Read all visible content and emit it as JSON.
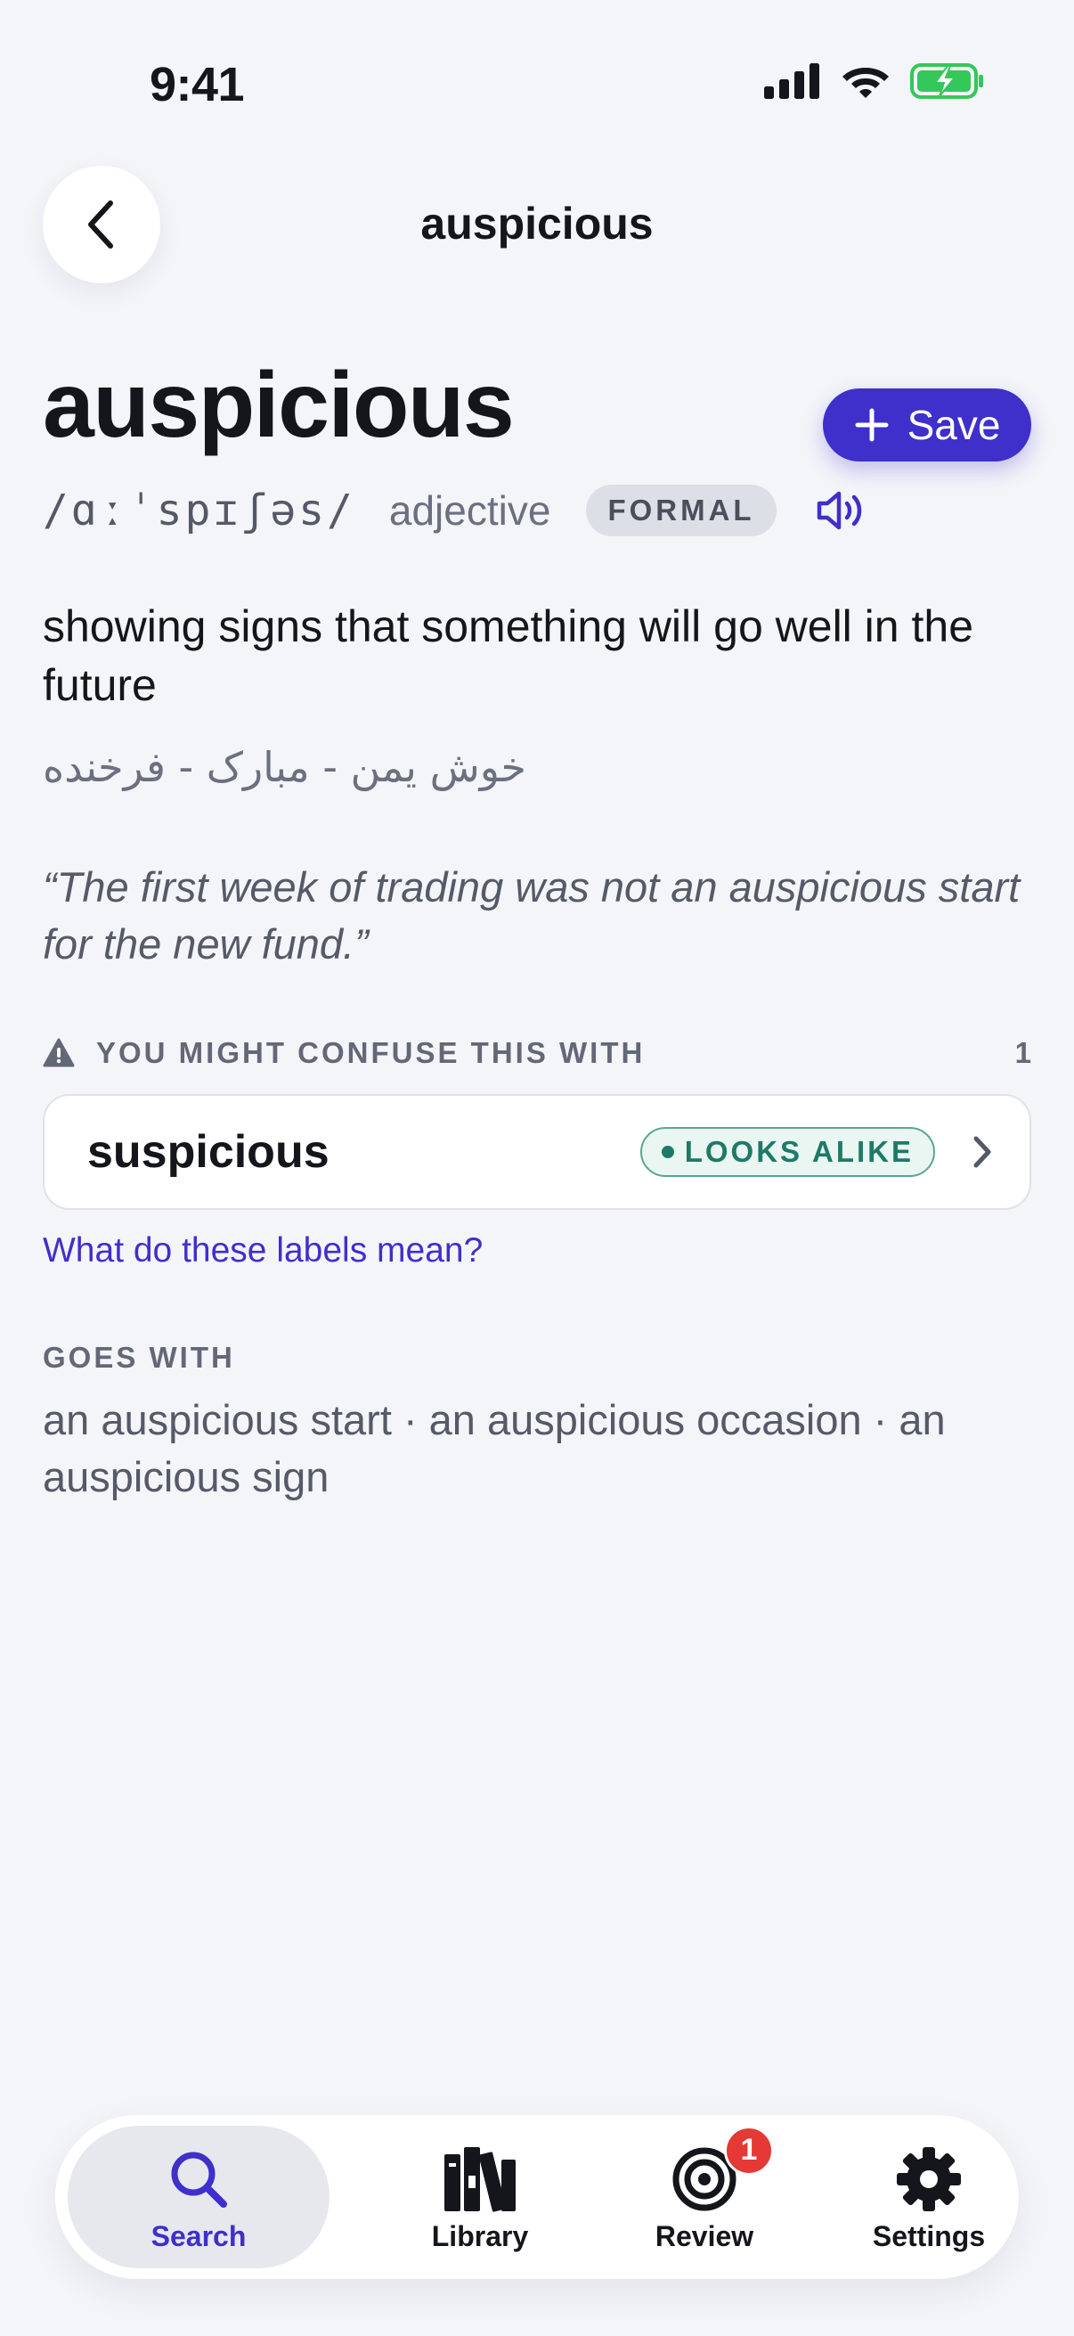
{
  "status_bar": {
    "time": "9:41"
  },
  "header": {
    "title": "auspicious"
  },
  "entry": {
    "word": "auspicious",
    "save_label": "Save",
    "ipa": "/ɑːˈspɪʃəs/",
    "part_of_speech": "adjective",
    "register_badge": "FORMAL",
    "definition": "showing signs that something will go well in the future",
    "translation": "خوش یمن - مبارک - فرخنده",
    "example": "“The first week of trading was not an auspicious start for the new fund.”"
  },
  "confusions": {
    "label": "YOU MIGHT CONFUSE THIS WITH",
    "count": "1",
    "items": [
      {
        "word": "suspicious",
        "badge": "LOOKS ALIKE"
      }
    ],
    "help_link": "What do these labels mean?"
  },
  "collocations": {
    "label": "GOES WITH",
    "text": "an auspicious start · an auspicious occasion · an auspicious sign"
  },
  "tabbar": {
    "tabs": [
      {
        "label": "Search",
        "icon": "search-icon",
        "active": true
      },
      {
        "label": "Library",
        "icon": "books-icon"
      },
      {
        "label": "Review",
        "icon": "target-icon",
        "badge": "1"
      },
      {
        "label": "Settings",
        "icon": "gear-icon"
      }
    ]
  },
  "colors": {
    "accent": "#3f2fcb",
    "background": "#f4f5f9",
    "looks_alike": "#1d7a66",
    "badge_red": "#e53935",
    "battery_green": "#34c759"
  }
}
